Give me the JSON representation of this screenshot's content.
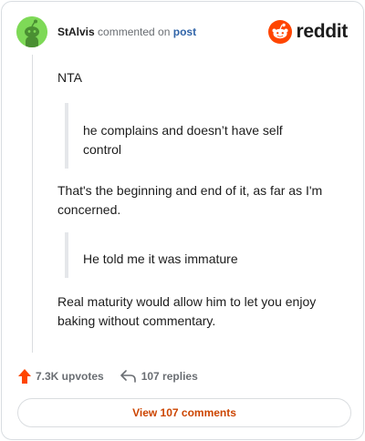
{
  "header": {
    "username": "StAlvis",
    "action_text": "commented on",
    "post_link": "post",
    "brand": "reddit"
  },
  "comment": {
    "paragraph_1": "NTA",
    "quote_1": "he complains and doesn’t have self control",
    "paragraph_2": "That's the beginning and end of it, as far as I'm concerned.",
    "quote_2": "He told me it was immature",
    "paragraph_3": "Real maturity would allow him to let you enjoy baking without commentary."
  },
  "stats": {
    "upvotes_label": "7.3K upvotes",
    "replies_label": "107 replies"
  },
  "footer": {
    "view_comments_label": "View 107 comments"
  },
  "colors": {
    "reddit_orange": "#ff4500",
    "link_blue": "#3064a8",
    "avatar_green": "#7ed957",
    "button_text": "#cc4500"
  },
  "icons": {
    "avatar": "snoo-avatar-icon",
    "brand": "reddit-logo-icon",
    "upvote": "upvote-arrow-icon",
    "reply": "reply-arrow-icon"
  }
}
